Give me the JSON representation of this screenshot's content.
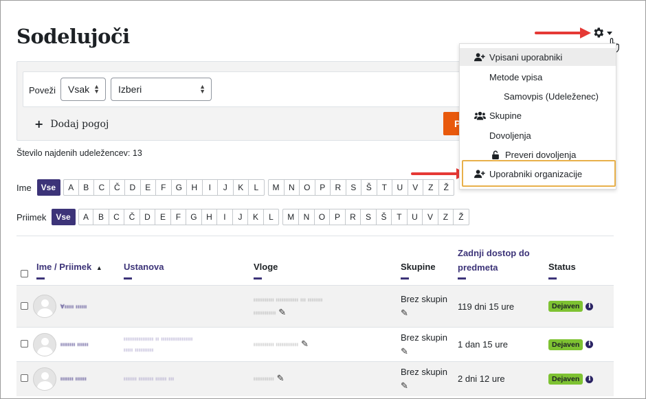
{
  "page": {
    "title": "Sodelujoči"
  },
  "filter": {
    "match_label": "Poveži",
    "match_select": "Vsak",
    "type_select": "Izberi",
    "add_condition": "Dodaj pogoj",
    "apply_label": "P"
  },
  "count_text": "Število najdenih udeležencev: 13",
  "initials": {
    "first_label": "Ime",
    "last_label": "Priimek",
    "all_label": "Vse",
    "groups": [
      [
        "A",
        "B",
        "C",
        "Č",
        "D",
        "E",
        "F",
        "G",
        "H",
        "I",
        "J",
        "K",
        "L"
      ],
      [
        "M",
        "N",
        "O",
        "P",
        "R",
        "S",
        "Š",
        "T",
        "U",
        "V",
        "Z",
        "Ž"
      ]
    ]
  },
  "table": {
    "headers": {
      "name": "Ime / Priimek",
      "institution": "Ustanova",
      "roles": "Vloge",
      "groups": "Skupine",
      "last_access": "Zadnji dostop do predmeta",
      "status": "Status"
    },
    "sort_indicator": "▲",
    "rows": [
      {
        "name": "Ɐııııı ıııııı",
        "institution": "",
        "roles": [
          "ııııııııııı ıııııııııııı ııı ıııııııı",
          "ıııııııııııı"
        ],
        "group": "Brez skupin",
        "last_access": "119 dni 15 ure",
        "status": "Dejaven"
      },
      {
        "name": "ıııııııı ıııııı",
        "institution": "ıııııııııııııııı ıı ııııııııııııııııı",
        "institution2": "ııııı ıııııııııı",
        "roles": [
          "ııııııııııı ıııııııııııı"
        ],
        "group": "Brez skupin",
        "last_access": "1 dan 15 ure",
        "status": "Dejaven"
      },
      {
        "name": "ııııııı ıııııı",
        "institution": "ııııııı ıııııııı ıııııı ııı",
        "roles": [
          "ııııııııııı"
        ],
        "group": "Brez skupin",
        "last_access": "2 dni 12 ure",
        "status": "Dejaven"
      }
    ]
  },
  "menu": {
    "items": [
      {
        "label": "Vpisani uporabniki",
        "icon": "user-plus-icon"
      },
      {
        "label": "Metode vpisa"
      },
      {
        "label": "Samovpis (Udeleženec)"
      },
      {
        "label": "Skupine",
        "icon": "users-icon"
      },
      {
        "label": "Dovoljenja"
      },
      {
        "label": "Preveri dovoljenja",
        "icon": "unlock-icon"
      },
      {
        "label": "Uporabniki organizacije",
        "icon": "user-plus-icon"
      }
    ]
  },
  "icons": {
    "gear": "gear-icon",
    "pencil": "pencil-icon",
    "info": "info-icon",
    "pointer": "hand-pointer-icon"
  },
  "colors": {
    "accent": "#3c3378",
    "status_active": "#7ec232",
    "arrow": "#e53935",
    "highlight_border": "#e8b04a",
    "apply_button": "#e8590c"
  }
}
